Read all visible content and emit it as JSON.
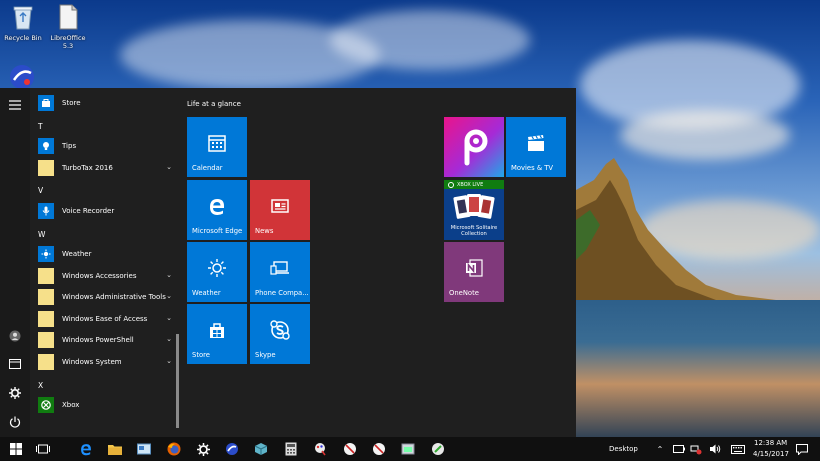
{
  "desktop": {
    "icons": [
      {
        "label": "Recycle Bin"
      },
      {
        "label": "LibreOffice 5.3"
      }
    ]
  },
  "start_menu": {
    "app_list": [
      {
        "type": "app",
        "label": "Store",
        "icon": "store-icon"
      },
      {
        "type": "letter",
        "label": "T"
      },
      {
        "type": "app",
        "label": "Tips",
        "icon": "tips-icon"
      },
      {
        "type": "folder",
        "label": "TurboTax 2016"
      },
      {
        "type": "letter",
        "label": "V"
      },
      {
        "type": "app",
        "label": "Voice Recorder",
        "icon": "microphone-icon"
      },
      {
        "type": "letter",
        "label": "W"
      },
      {
        "type": "app",
        "label": "Weather",
        "icon": "sun-icon"
      },
      {
        "type": "folder",
        "label": "Windows Accessories"
      },
      {
        "type": "folder",
        "label": "Windows Administrative Tools"
      },
      {
        "type": "folder",
        "label": "Windows Ease of Access"
      },
      {
        "type": "folder",
        "label": "Windows PowerShell"
      },
      {
        "type": "folder",
        "label": "Windows System"
      },
      {
        "type": "letter",
        "label": "X"
      },
      {
        "type": "app",
        "label": "Xbox",
        "icon": "xbox-icon"
      }
    ],
    "tile_group_title": "Life at a glance",
    "tiles": {
      "calendar": "Calendar",
      "edge": "Microsoft Edge",
      "news": "News",
      "weather": "Weather",
      "phone": "Phone Compa...",
      "store": "Store",
      "skype": "Skype",
      "picsart": "",
      "movies": "Movies & TV",
      "solitaire_badge": "XBOX LIVE",
      "solitaire": "Microsoft Solitaire Collection",
      "onenote": "OneNote"
    }
  },
  "taskbar": {
    "desktop_label": "Desktop",
    "time": "12:38 AM",
    "date": "4/15/2017"
  },
  "colors": {
    "tile_blue": "#0078d7",
    "news_red": "#d13438",
    "onenote_purple": "#80397b",
    "solitaire_navy": "#0b3f8a",
    "xbox_green": "#107c10"
  }
}
